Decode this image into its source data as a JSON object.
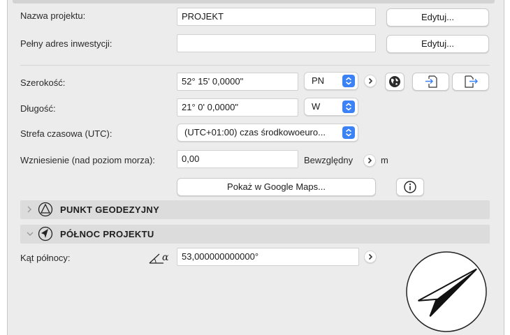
{
  "project": {
    "name_label": "Nazwa projektu:",
    "name_value": "PROJEKT",
    "name_edit": "Edytuj...",
    "address_label": "Pełny adres inwestycji:",
    "address_value": "",
    "address_edit": "Edytuj..."
  },
  "location": {
    "latitude_label": "Szerokość:",
    "latitude_value": "52° 15' 0,0000\"",
    "latitude_dir": "PN",
    "longitude_label": "Długość:",
    "longitude_value": "21° 0' 0,0000\"",
    "longitude_dir": "W",
    "timezone_label": "Strefa czasowa (UTC):",
    "timezone_value": "(UTC+01:00) czas środkowoeuro...",
    "elevation_label": "Wzniesienie (nad poziom morza):",
    "elevation_value": "0,00",
    "elevation_mode": "Bewzględny",
    "elevation_unit": "m",
    "maps_button": "Pokaż w Google Maps..."
  },
  "sections": {
    "survey_point": "PUNKT GEODEZYJNY",
    "project_north": "PÓŁNOC PROJEKTU"
  },
  "north": {
    "angle_label": "Kąt północy:",
    "angle_value": "53,000000000000°",
    "angle_symbol": "α",
    "angle_degrees": 53
  },
  "icons": [
    "globe-icon",
    "import-icon",
    "export-icon",
    "info-icon",
    "compass-icon",
    "survey-point-icon",
    "north-arrow-icon",
    "angle-icon"
  ],
  "colors": {
    "accent": "#3b82f6",
    "panel": "#ececec",
    "section": "#dcdcdc"
  }
}
